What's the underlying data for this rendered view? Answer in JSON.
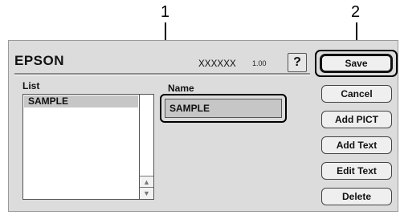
{
  "callouts": [
    "1",
    "2"
  ],
  "header": {
    "brand": "EPSON",
    "model": "XXXXXX",
    "version": "1.00",
    "help": "?"
  },
  "list": {
    "label": "List",
    "items": [
      "SAMPLE"
    ],
    "scroll_up": "▲",
    "scroll_down": "▼"
  },
  "name": {
    "label": "Name",
    "value": "SAMPLE"
  },
  "buttons": {
    "save": "Save",
    "cancel": "Cancel",
    "add_pict": "Add PICT",
    "add_text": "Add Text",
    "edit_text": "Edit Text",
    "delete": "Delete"
  }
}
